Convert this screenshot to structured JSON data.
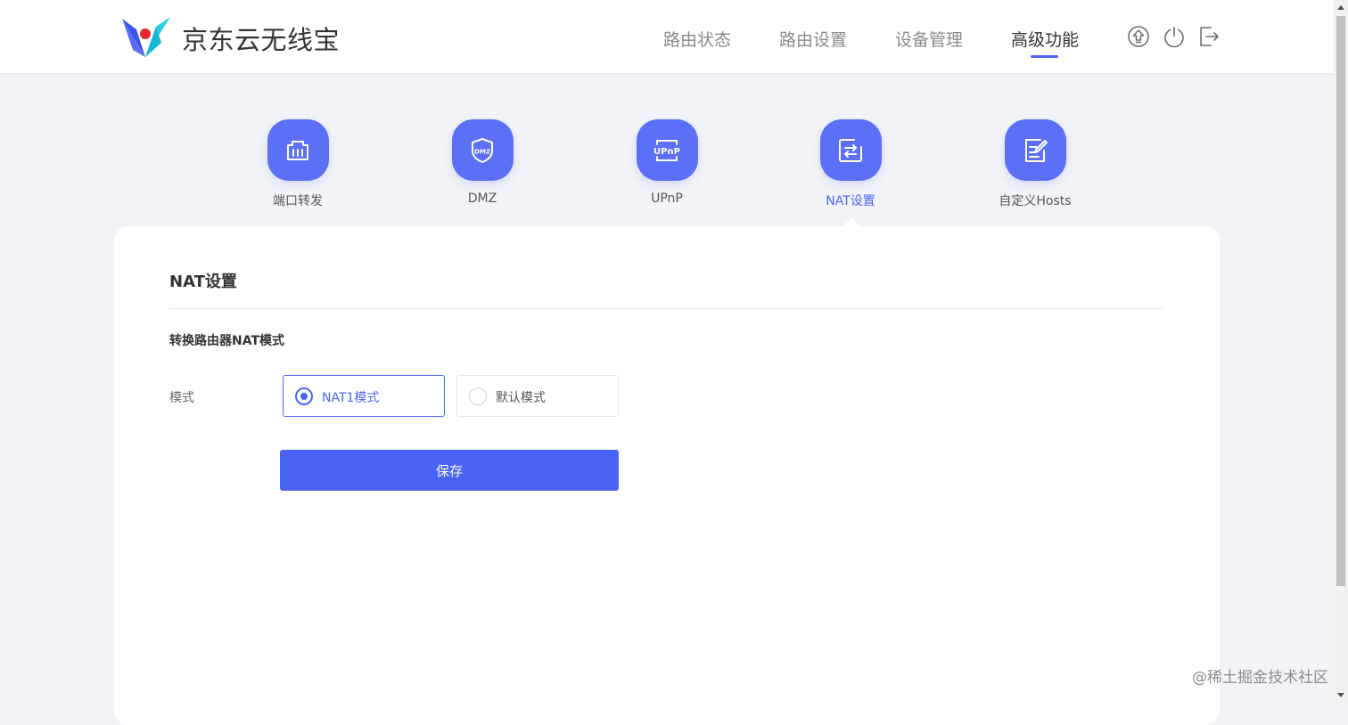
{
  "header": {
    "brand": "京东云无线宝",
    "nav": [
      {
        "label": "路由状态"
      },
      {
        "label": "路由设置"
      },
      {
        "label": "设备管理"
      },
      {
        "label": "高级功能",
        "active": true
      }
    ],
    "icons": [
      "upgrade-icon",
      "power-icon",
      "logout-icon"
    ]
  },
  "features": [
    {
      "label": "端口转发",
      "icon": "port-forward-icon"
    },
    {
      "label": "DMZ",
      "icon": "dmz-shield-icon"
    },
    {
      "label": "UPnP",
      "icon": "upnp-icon"
    },
    {
      "label": "NAT设置",
      "icon": "nat-icon",
      "active": true
    },
    {
      "label": "自定义Hosts",
      "icon": "edit-hosts-icon"
    }
  ],
  "panel": {
    "title": "NAT设置",
    "section_title": "转换路由器NAT模式",
    "mode_label": "模式",
    "options": [
      {
        "label": "NAT1模式",
        "selected": true
      },
      {
        "label": "默认模式",
        "selected": false
      }
    ],
    "save_label": "保存"
  },
  "watermark": "@稀土掘金技术社区",
  "colors": {
    "accent": "#4b63f5",
    "icon_bg": "#5b6ff7",
    "page_bg": "#f1f3f8"
  }
}
